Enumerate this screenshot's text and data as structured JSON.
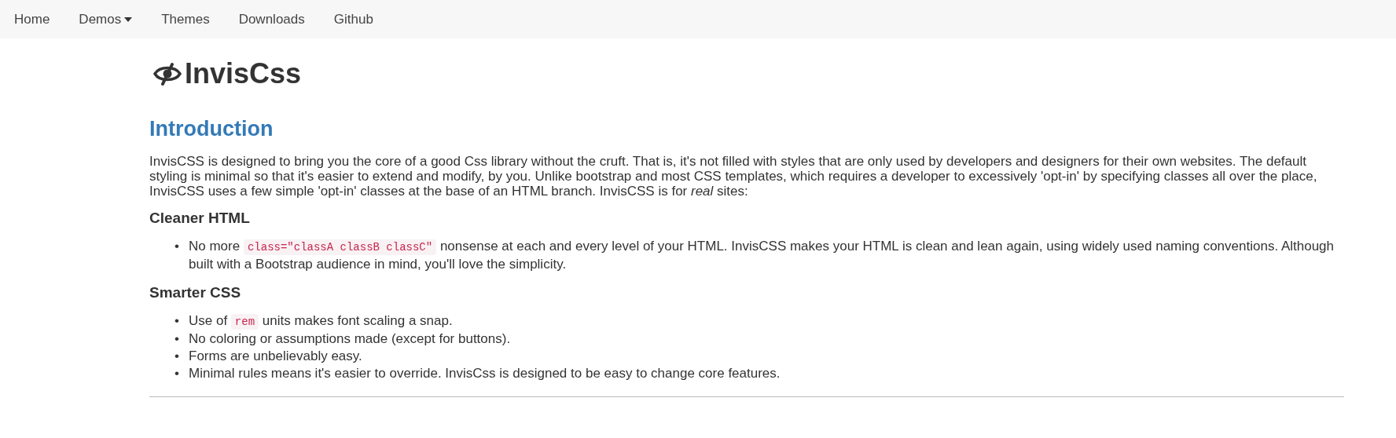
{
  "navbar": {
    "items": [
      {
        "label": "Home",
        "dropdown": false
      },
      {
        "label": "Demos",
        "dropdown": true
      },
      {
        "label": "Themes",
        "dropdown": false
      },
      {
        "label": "Downloads",
        "dropdown": false
      },
      {
        "label": "Github",
        "dropdown": false
      }
    ]
  },
  "brand": {
    "title": "InvisCss"
  },
  "sections": [
    {
      "kind": "h2",
      "text": "Introduction"
    },
    {
      "kind": "p",
      "text": "InvisCSS is designed to bring you the core of a good Css library without the cruft. That is, it's not filled with styles that are only used by developers and designers for their own websites. The default styling is minimal so that it's easier to extend and modify, by you. Unlike bootstrap and most CSS templates, which requires a developer to excessively 'opt-in' by specifying classes all over the place, InvisCSS uses a few simple 'opt-in' classes at the base of an HTML branch. InvisCSS is for *real* sites:"
    },
    {
      "kind": "h3",
      "text": "Cleaner HTML"
    },
    {
      "kind": "ul",
      "items": [
        {
          "marker": "•",
          "parts": [
            {
              "kind": "text",
              "text": "No more "
            },
            {
              "kind": "code",
              "text": "class=\"classA classB classC\""
            },
            {
              "kind": "text",
              "text": " nonsense at each and every level of your HTML. InvisCSS makes your HTML is clean and lean again, using widely used naming conventions. Although built with a Bootstrap audience in mind, you'll love the simplicity."
            }
          ]
        }
      ]
    },
    {
      "kind": "h3",
      "text": "Smarter CSS"
    },
    {
      "kind": "ul",
      "items": [
        {
          "marker": "•",
          "parts": [
            {
              "kind": "text",
              "text": "Use of "
            },
            {
              "kind": "code",
              "text": "rem"
            },
            {
              "kind": "text",
              "text": " units makes font scaling a snap."
            }
          ]
        },
        {
          "marker": "•",
          "parts": [
            {
              "kind": "text",
              "text": "No coloring or assumptions made (except for buttons)."
            }
          ]
        },
        {
          "marker": "•",
          "parts": [
            {
              "kind": "text",
              "text": "Forms are unbelievably easy."
            }
          ]
        },
        {
          "marker": "•",
          "parts": [
            {
              "kind": "text",
              "text": "Minimal rules means it's easier to override. InvisCss is designed to be easy to change core features."
            }
          ]
        }
      ]
    },
    {
      "kind": "hr"
    }
  ]
}
